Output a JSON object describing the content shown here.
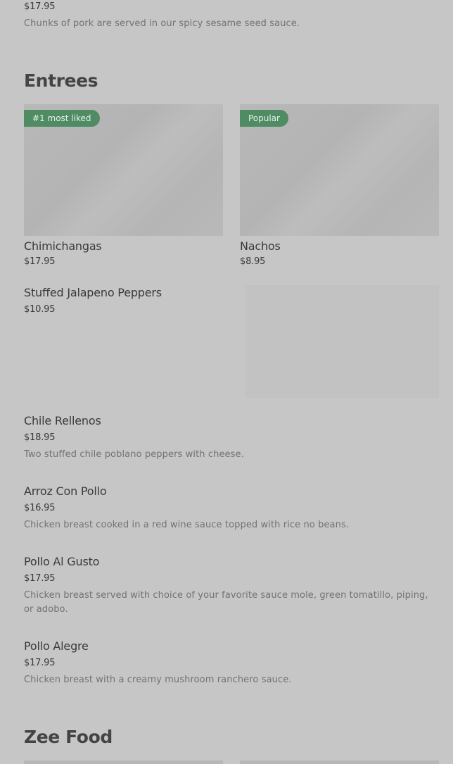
{
  "top_item": {
    "price": "$17.95",
    "description": "Chunks of pork are served in our spicy sesame seed sauce."
  },
  "entrees": {
    "title": "Entrees",
    "featured": [
      {
        "badge": "#1 most liked",
        "name": "Chimichangas",
        "price": "$17.95"
      },
      {
        "badge": "Popular",
        "name": "Nachos",
        "price": "$8.95"
      }
    ],
    "items": [
      {
        "name": "Stuffed Jalapeno Peppers",
        "price": "$10.95",
        "description": ""
      },
      {
        "name": "Chile Rellenos",
        "price": "$18.95",
        "description": "Two stuffed chile poblano peppers with cheese."
      },
      {
        "name": "Arroz Con Pollo",
        "price": "$16.95",
        "description": "Chicken breast cooked in a red wine sauce topped with rice no beans."
      },
      {
        "name": "Pollo Al Gusto",
        "price": "$17.95",
        "description": "Chicken breast served with choice of your favorite sauce mole, green tomatillo, piping, or adobo."
      },
      {
        "name": "Pollo Alegre",
        "price": "$17.95",
        "description": "Chicken breast with a creamy mushroom ranchero sauce."
      }
    ]
  },
  "zee_food": {
    "title": "Zee Food"
  }
}
